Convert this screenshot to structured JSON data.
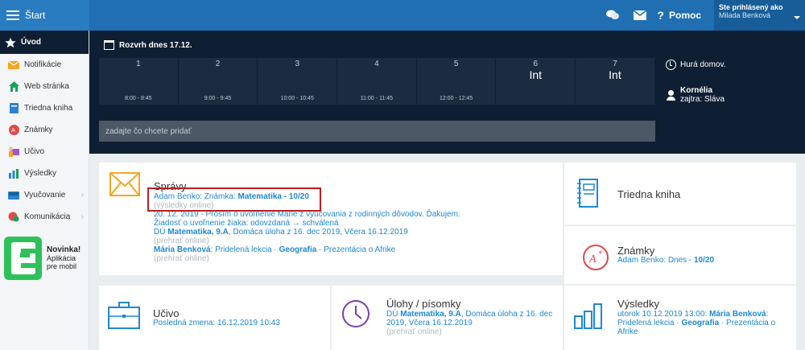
{
  "topbar": {
    "start_label": "Štart",
    "help_label": "Pomoc",
    "user_logged_label": "Ste prihlásený ako",
    "user_name": "Milada Benková"
  },
  "sidebar": {
    "items": [
      {
        "label": "Úvod",
        "icon": "star-icon"
      },
      {
        "label": "Notifikácie",
        "icon": "envelope-icon"
      },
      {
        "label": "Web stránka",
        "icon": "home-icon"
      },
      {
        "label": "Triedna kniha",
        "icon": "book-icon"
      },
      {
        "label": "Známky",
        "icon": "grade-icon"
      },
      {
        "label": "Učivo",
        "icon": "teacher-icon"
      },
      {
        "label": "Výsledky",
        "icon": "bar-chart-icon"
      },
      {
        "label": "Vyučovanie",
        "icon": "classroom-icon"
      },
      {
        "label": "Komunikácia",
        "icon": "chat-icon"
      }
    ],
    "promo_title": "Novinka!",
    "promo_line1": "Aplikácia",
    "promo_line2": "pre mobil"
  },
  "schedule": {
    "title": "Rozvrh dnes 17.12.",
    "periods": [
      {
        "num": "1",
        "time": "8:00 - 8:45",
        "subject": ""
      },
      {
        "num": "2",
        "time": "9:00 - 9:45",
        "subject": ""
      },
      {
        "num": "3",
        "time": "10:00 - 10:45",
        "subject": ""
      },
      {
        "num": "4",
        "time": "11:00 - 11:45",
        "subject": ""
      },
      {
        "num": "5",
        "time": "12:00 - 12:45",
        "subject": ""
      },
      {
        "num": "6",
        "time": "",
        "subject": "Int"
      },
      {
        "num": "7",
        "time": "",
        "subject": "Int"
      }
    ],
    "input_placeholder": "zadajte čo chcete pridať",
    "home_label": "Hurá domov.",
    "nameday_name": "Kornélia",
    "nameday_tomorrow": "zajtra: Sláva"
  },
  "spravy": {
    "title": "Správy",
    "m1_sender": "Adam Benko",
    "m1_type": ": Známka: ",
    "m1_subject": "Matematika - 10/20",
    "m1_note": "(výsledky online)",
    "m2_text": "20. 12. 2019 - Prosím o uvoľnenie Márie z vyučovania z rodinných dôvodov. Ďakujem.",
    "m3_text": "Žiadosť o uvoľnenie žiaka: odovzdaná → schválená",
    "m4_prefix": "DÚ ",
    "m4_subject": "Matematika, 9.A",
    "m4_rest": ", Domáca úloha z 16. dec 2019, Včera 16.12.2019",
    "m4_note": "(prehrať online)",
    "m5_sender": "Mária Benková",
    "m5_text1": ": Pridelená lekcia · ",
    "m5_subject": "Geografia",
    "m5_text2": " · Prezentácia o Afrike",
    "m5_note": "(prehrať online)"
  },
  "triedna": {
    "title": "Triedna kniha"
  },
  "znamky": {
    "title": "Známky",
    "sub_prefix": "Adam Benko: Dnes - ",
    "sub_value": "10/20"
  },
  "ucivo": {
    "title": "Učivo",
    "sub": "Posledná zmena: 16.12.2019 10:43"
  },
  "ulohy": {
    "title": "Úlohy / písomky",
    "sub_prefix": "DÚ ",
    "sub_subject": "Matematika, 9.A",
    "sub_rest": ", Domáca úloha z 16. dec 2019, Včera 16.12.2019",
    "sub_note": "(prehrať online)"
  },
  "vysledky": {
    "title": "Výsledky",
    "sub_date": "utorok 10.12.2019 13:00: ",
    "sub_name": "Mária Benková",
    "sub_text1": ": Pridelená lekcia · ",
    "sub_subject": "Geografia",
    "sub_text2": " · Prezentácia o Afrike"
  },
  "colors": {
    "topbar": "#1f6fb2",
    "dark_panel": "#0f1f33",
    "link": "#1e88d6",
    "accent_orange": "#f5a623",
    "highlight": "#c01d23"
  }
}
